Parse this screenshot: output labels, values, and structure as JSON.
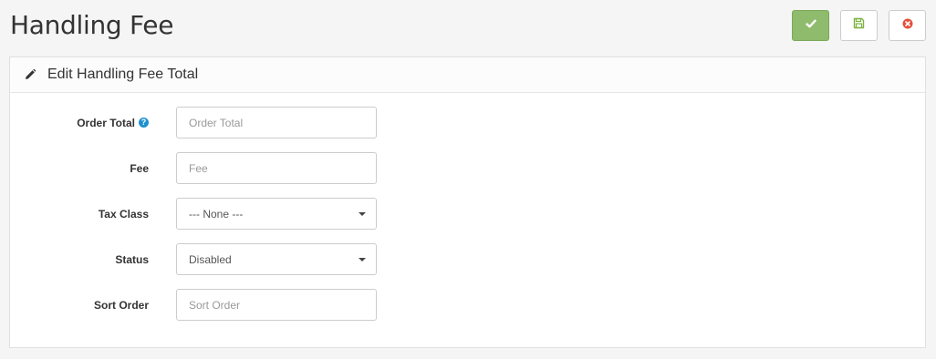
{
  "page": {
    "title": "Handling Fee"
  },
  "toolbar": {
    "save_icon": "check-icon",
    "secondary_icon": "floppy-disk-icon",
    "cancel_icon": "cancel-circle-icon",
    "save_color": "#8fbb6c",
    "cancel_color": "#e3503e"
  },
  "panel": {
    "heading_icon": "pencil-icon",
    "title": "Edit Handling Fee Total"
  },
  "form": {
    "order_total": {
      "label": "Order Total",
      "help_icon": "question-circle-icon",
      "help_glyph": "?",
      "value": "",
      "placeholder": "Order Total"
    },
    "fee": {
      "label": "Fee",
      "value": "",
      "placeholder": "Fee"
    },
    "tax_class": {
      "label": "Tax Class",
      "selected": "--- None ---"
    },
    "status": {
      "label": "Status",
      "selected": "Disabled"
    },
    "sort_order": {
      "label": "Sort Order",
      "value": "",
      "placeholder": "Sort Order"
    }
  }
}
